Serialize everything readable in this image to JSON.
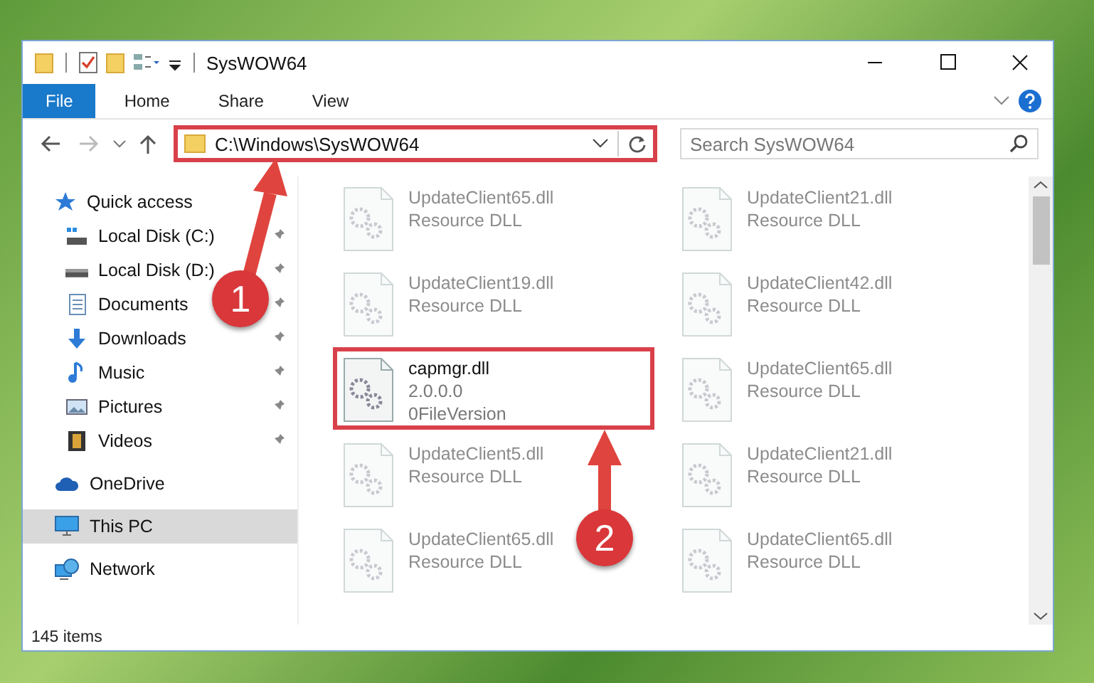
{
  "window": {
    "title": "SysWOW64"
  },
  "ribbon_tabs": [
    {
      "label": "File",
      "kind": "file"
    },
    {
      "label": "Home",
      "kind": "tab"
    },
    {
      "label": "Share",
      "kind": "tab"
    },
    {
      "label": "View",
      "kind": "tab"
    }
  ],
  "address_bar": {
    "path": "C:\\Windows\\SysWOW64",
    "highlighted": true
  },
  "search": {
    "placeholder": "Search SysWOW64"
  },
  "sidebar": {
    "items": [
      {
        "label": "Quick access",
        "kind": "star",
        "selected": false,
        "children": [
          {
            "label": "Local Disk (C:)",
            "kind": "drive-windows",
            "pinned": true
          },
          {
            "label": "Local Disk (D:)",
            "kind": "drive",
            "pinned": true
          },
          {
            "label": "Documents",
            "kind": "documents",
            "pinned": true
          },
          {
            "label": "Downloads",
            "kind": "downloads",
            "pinned": true
          },
          {
            "label": "Music",
            "kind": "music",
            "pinned": true
          },
          {
            "label": "Pictures",
            "kind": "pictures",
            "pinned": true
          },
          {
            "label": "Videos",
            "kind": "videos",
            "pinned": true
          }
        ]
      },
      {
        "label": "OneDrive",
        "kind": "cloud",
        "selected": false
      },
      {
        "label": "This PC",
        "kind": "pc",
        "selected": true
      },
      {
        "label": "Network",
        "kind": "network",
        "selected": false
      }
    ]
  },
  "files": [
    {
      "name": "UpdateClient65.dll",
      "line_2": "Resource DLL",
      "blurred": true,
      "highlighted": false
    },
    {
      "name": "UpdateClient21.dll",
      "line_2": "Resource DLL",
      "blurred": true,
      "highlighted": false
    },
    {
      "name": "UpdateClient19.dll",
      "line_2": "Resource DLL",
      "blurred": true,
      "highlighted": false
    },
    {
      "name": "UpdateClient42.dll",
      "line_2": "Resource DLL",
      "blurred": true,
      "highlighted": false
    },
    {
      "name": "capmgr.dll",
      "line_2": "2.0.0.0",
      "line_3": "0FileVersion",
      "blurred": false,
      "highlighted": true
    },
    {
      "name": "UpdateClient65.dll",
      "line_2": "Resource DLL",
      "blurred": true,
      "highlighted": false
    },
    {
      "name": "UpdateClient5.dll",
      "line_2": "Resource DLL",
      "blurred": true,
      "highlighted": false
    },
    {
      "name": "UpdateClient21.dll",
      "line_2": "Resource DLL",
      "blurred": true,
      "highlighted": false
    },
    {
      "name": "UpdateClient65.dll",
      "line_2": "Resource DLL",
      "blurred": true,
      "highlighted": false
    },
    {
      "name": "UpdateClient65.dll",
      "line_2": "Resource DLL",
      "blurred": true,
      "highlighted": false
    }
  ],
  "status_bar": {
    "item_count": "145 items"
  },
  "annotations": [
    {
      "number": "1"
    },
    {
      "number": "2"
    }
  ]
}
